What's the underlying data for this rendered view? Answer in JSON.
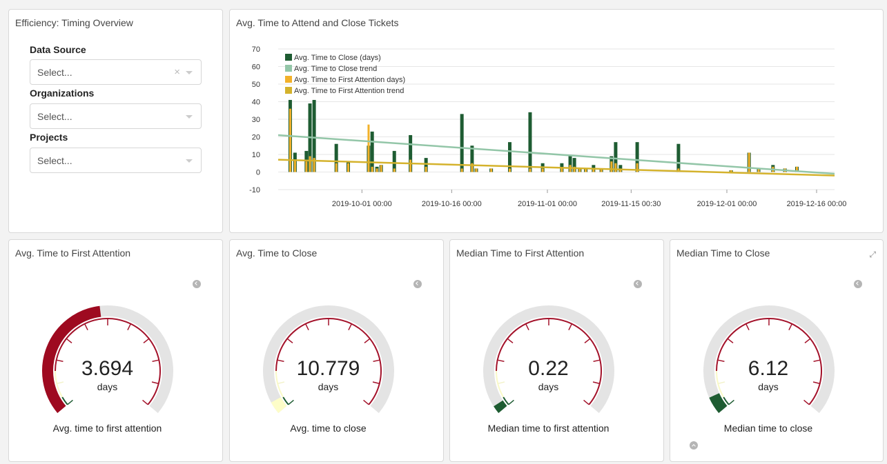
{
  "filters_panel": {
    "title": "Efficiency: Timing Overview",
    "data_source": {
      "label": "Data Source",
      "placeholder": "Select...",
      "clear": "×"
    },
    "organizations": {
      "label": "Organizations",
      "placeholder": "Select..."
    },
    "projects": {
      "label": "Projects",
      "placeholder": "Select..."
    }
  },
  "chart_panel": {
    "title": "Avg. Time to Attend and Close Tickets"
  },
  "chart_data": {
    "type": "bar",
    "title": "Avg. Time to Attend and Close Tickets",
    "xlabel": "",
    "ylabel": "",
    "ylim": [
      -10,
      70
    ],
    "y_ticks": [
      70,
      60,
      50,
      40,
      30,
      20,
      10,
      0,
      -10
    ],
    "x_tick_labels": [
      "2019-10-01 00:00",
      "2019-10-16 00:00",
      "2019-11-01 00:00",
      "2019-11-15 00:30",
      "2019-12-01 00:00",
      "2019-12-16 00:00"
    ],
    "x_tick_days": [
      14,
      29,
      45,
      59,
      75,
      90
    ],
    "x_range_days": [
      0,
      93
    ],
    "legend": [
      "Avg. Time to Close (days)",
      "Avg. Time to Close trend",
      "Avg. Time to First Attention days)",
      "Avg. Time to First Attention trend"
    ],
    "legend_placement": "top-left",
    "grid": true,
    "colors": {
      "close": "#1e5c32",
      "close_trend": "#93c6a8",
      "attention": "#f2b12a",
      "attention_trend": "#d4b22c"
    },
    "bars": [
      {
        "day": 2.3,
        "close": 41,
        "attention": 36
      },
      {
        "day": 3.1,
        "close": 11,
        "attention": 7
      },
      {
        "day": 5.0,
        "close": 12,
        "attention": 6
      },
      {
        "day": 5.6,
        "close": 39,
        "attention": 9
      },
      {
        "day": 6.3,
        "close": 41,
        "attention": 8
      },
      {
        "day": 10.0,
        "close": 16,
        "attention": 5
      },
      {
        "day": 12.0,
        "close": 6,
        "attention": 5
      },
      {
        "day": 15.4,
        "close": 15,
        "attention": 27
      },
      {
        "day": 16.0,
        "close": 23,
        "attention": 3
      },
      {
        "day": 16.8,
        "close": 3,
        "attention": 2
      },
      {
        "day": 17.5,
        "close": 4,
        "attention": 4
      },
      {
        "day": 19.7,
        "close": 12,
        "attention": 2
      },
      {
        "day": 22.4,
        "close": 21,
        "attention": 7
      },
      {
        "day": 25.0,
        "close": 8,
        "attention": 3
      },
      {
        "day": 31.0,
        "close": 33,
        "attention": 2
      },
      {
        "day": 32.7,
        "close": 15,
        "attention": 5
      },
      {
        "day": 33.4,
        "close": 2,
        "attention": 2
      },
      {
        "day": 35.9,
        "close": 2,
        "attention": 2
      },
      {
        "day": 39.0,
        "close": 17,
        "attention": 2
      },
      {
        "day": 42.4,
        "close": 34,
        "attention": 2
      },
      {
        "day": 44.5,
        "close": 5,
        "attention": 2
      },
      {
        "day": 47.7,
        "close": 5,
        "attention": 2
      },
      {
        "day": 49.1,
        "close": 9,
        "attention": 4
      },
      {
        "day": 49.8,
        "close": 8,
        "attention": 3
      },
      {
        "day": 50.7,
        "close": 2,
        "attention": 2
      },
      {
        "day": 51.7,
        "close": 2,
        "attention": 2
      },
      {
        "day": 53.0,
        "close": 4,
        "attention": 2
      },
      {
        "day": 54.3,
        "close": 2,
        "attention": 2
      },
      {
        "day": 56.0,
        "close": 9,
        "attention": 6
      },
      {
        "day": 56.7,
        "close": 17,
        "attention": 5
      },
      {
        "day": 57.5,
        "close": 4,
        "attention": 2
      },
      {
        "day": 60.3,
        "close": 17,
        "attention": 5
      },
      {
        "day": 67.2,
        "close": 16,
        "attention": 2
      },
      {
        "day": 76.0,
        "close": 1,
        "attention": 1
      },
      {
        "day": 79.0,
        "close": 11,
        "attention": 11
      },
      {
        "day": 80.6,
        "close": 2,
        "attention": 2
      },
      {
        "day": 83.0,
        "close": 4,
        "attention": 3
      },
      {
        "day": 85.0,
        "close": 2,
        "attention": 2
      },
      {
        "day": 87.0,
        "close": 3,
        "attention": 3
      }
    ],
    "close_trend": [
      [
        0,
        21
      ],
      [
        93,
        -1
      ]
    ],
    "attention_trend": [
      [
        0,
        7
      ],
      [
        93,
        -2
      ]
    ]
  },
  "gauges": [
    {
      "title": "Avg. Time to First Attention",
      "value": "3.694",
      "unit": "days",
      "label": "Avg. time to first attention",
      "fill_fraction": 0.473,
      "fill_color": "#9e0a20",
      "show_expand": false,
      "show_up": false
    },
    {
      "title": "Avg. Time to Close",
      "value": "10.779",
      "unit": "days",
      "label": "Avg. time to close",
      "fill_fraction": 0.043,
      "fill_color": "#fdfdc8",
      "show_expand": false,
      "show_up": false
    },
    {
      "title": "Median Time to First Attention",
      "value": "0.22",
      "unit": "days",
      "label": "Median time to first attention",
      "fill_fraction": 0.028,
      "fill_color": "#1e5c32",
      "show_expand": false,
      "show_up": false
    },
    {
      "title": "Median Time to Close",
      "value": "6.12",
      "unit": "days",
      "label": "Median time to close",
      "fill_fraction": 0.061,
      "fill_color": "#1e5c32",
      "show_expand": true,
      "show_up": true
    }
  ]
}
